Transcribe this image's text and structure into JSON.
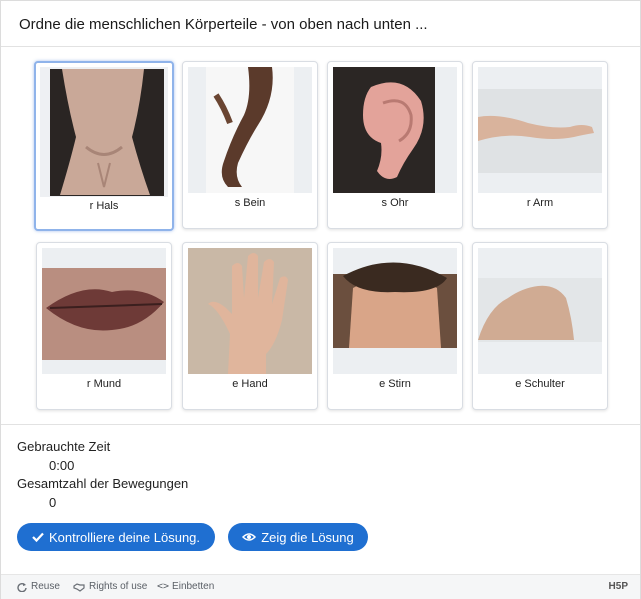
{
  "task": {
    "title": "Ordne die menschlichen Körperteile - von oben nach unten ..."
  },
  "cards": [
    {
      "label": "r Hals",
      "image": "neck"
    },
    {
      "label": "s Bein",
      "image": "leg"
    },
    {
      "label": "s Ohr",
      "image": "ear"
    },
    {
      "label": "r Arm",
      "image": "arm"
    },
    {
      "label": "r Mund",
      "image": "mouth"
    },
    {
      "label": "e Hand",
      "image": "hand"
    },
    {
      "label": "e Stirn",
      "image": "forehead"
    },
    {
      "label": "e Schulter",
      "image": "shoulder"
    }
  ],
  "stats": {
    "time_label": "Gebrauchte Zeit",
    "time_value": "0:00",
    "moves_label": "Gesamtzahl der Bewegungen",
    "moves_value": "0"
  },
  "buttons": {
    "check": "Kontrolliere deine Lösung.",
    "show": "Zeig die Lösung"
  },
  "footer": {
    "reuse": "Reuse",
    "rights": "Rights of use",
    "embed": "Einbetten",
    "brand": "H5P"
  },
  "colors": {
    "accent": "#1f6fd1",
    "selected_border": "#8fb3ea"
  }
}
